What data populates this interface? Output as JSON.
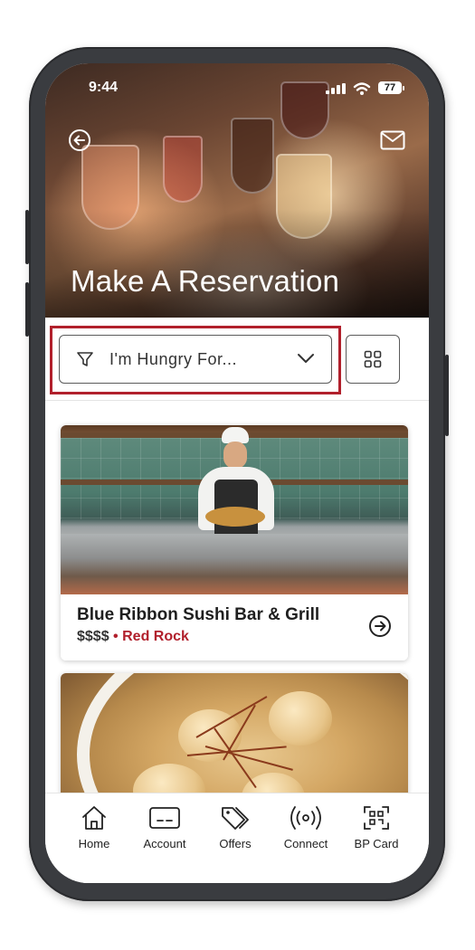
{
  "status_bar": {
    "time": "9:44",
    "battery": "77"
  },
  "header": {
    "title": "Make A Reservation"
  },
  "filter": {
    "placeholder": "I'm Hungry For..."
  },
  "restaurants": [
    {
      "name": "Blue Ribbon Sushi Bar & Grill",
      "price": "$$$$",
      "separator": "•",
      "location": "Red Rock"
    }
  ],
  "tabbar": {
    "items": [
      {
        "label": "Home",
        "icon": "home-icon"
      },
      {
        "label": "Account",
        "icon": "card-icon"
      },
      {
        "label": "Offers",
        "icon": "tags-icon"
      },
      {
        "label": "Connect",
        "icon": "broadcast-icon"
      },
      {
        "label": "BP Card",
        "icon": "qr-scan-icon"
      }
    ]
  },
  "colors": {
    "accent_red": "#b1202c",
    "phone_frame": "#3a3c40"
  }
}
